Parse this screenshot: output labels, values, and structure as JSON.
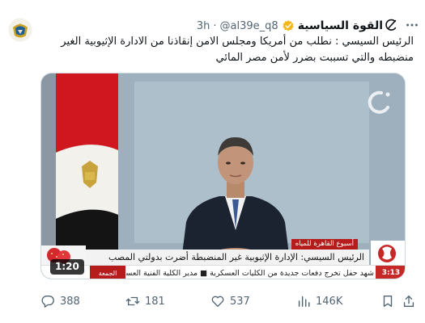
{
  "header": {
    "display_name": "القوة السياسية",
    "handle": "@al39e_q8",
    "separator": "·",
    "time": "3h"
  },
  "tweet": {
    "text": "الرئيس السيسي : نطلب من أمريكا ومجلس الامن إنقاذنا من الادارة الإثيوبية الغير منضبطه والتي تسببت بضرر لأمن مصر المائي"
  },
  "media": {
    "banner_tag": "أسبوع القاهرة للمياه",
    "headline": "الرئيس السيسي: الإدارة الإثيوبية غير المنضبطة أضرت بدولتي المصب",
    "ticker": "شهد حفل تخرج دفعات جديدة من الكليات العسكرية  ■  مدير الكلية الفنية العسكرية",
    "ticker_tag": "الجمعة",
    "clock": "3:13",
    "duration": "1:20"
  },
  "actions": {
    "replies": "388",
    "reposts": "181",
    "likes": "537",
    "views": "146K"
  },
  "colors": {
    "text": "#0f1419",
    "muted": "#536471",
    "verified": "#f4b81d",
    "border": "#cfd9de"
  },
  "icons": [
    "avatar-seal",
    "verified-badge-icon",
    "grok-icon",
    "more-icon",
    "reply-icon",
    "repost-icon",
    "like-icon",
    "views-icon",
    "bookmark-icon",
    "share-icon"
  ]
}
